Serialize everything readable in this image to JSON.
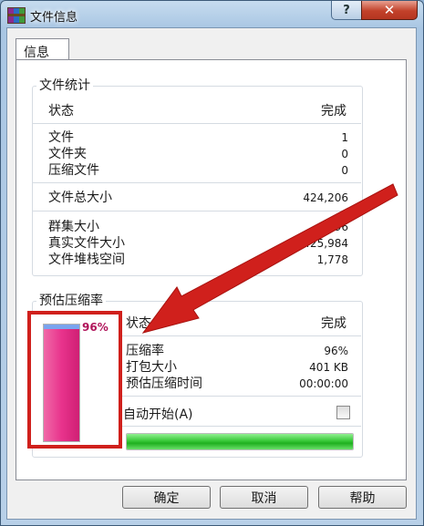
{
  "window": {
    "title": "文件信息",
    "help_label": "?",
    "close_label": "✕"
  },
  "tabs": [
    {
      "label": "信息"
    }
  ],
  "stats_group": {
    "title": "文件统计",
    "header": {
      "label": "状态",
      "value": "完成"
    },
    "counts": [
      {
        "label": "文件",
        "value": "1"
      },
      {
        "label": "文件夹",
        "value": "0"
      },
      {
        "label": "压缩文件",
        "value": "0"
      }
    ],
    "total": {
      "label": "文件总大小",
      "value": "424,206"
    },
    "sizes": [
      {
        "label": "群集大小",
        "value": "4,096"
      },
      {
        "label": "真实文件大小",
        "value": "425,984"
      },
      {
        "label": "文件堆栈空间",
        "value": "1,778"
      }
    ]
  },
  "ratio_group": {
    "title": "预估压缩率",
    "percent_label": "96%",
    "percent_value": 96,
    "header": {
      "label": "状态",
      "value": "完成"
    },
    "rows": [
      {
        "label": "压缩率",
        "value": "96%"
      },
      {
        "label": "打包大小",
        "value": "401 KB"
      },
      {
        "label": "预估压缩时间",
        "value": "00:00:00"
      }
    ],
    "auto_start_label": "自动开始(A)",
    "auto_start_checked": false,
    "progress_value": 100
  },
  "buttons": {
    "ok": "确定",
    "cancel": "取消",
    "help": "帮助"
  },
  "colors": {
    "annotation_red": "#d0201c",
    "progress_green": "#30c030",
    "ratio_pink": "#e8338c"
  }
}
